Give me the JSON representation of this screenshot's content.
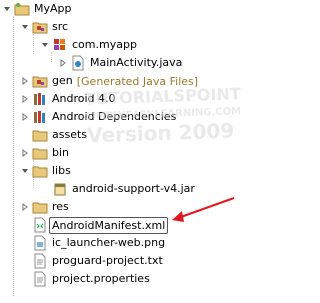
{
  "project": {
    "name": "MyApp",
    "items": [
      {
        "label": "src",
        "icon": "source-folder-icon"
      },
      {
        "label": "com.myapp",
        "icon": "package-icon"
      },
      {
        "label": "MainActivity.java",
        "icon": "java-file-icon"
      },
      {
        "label": "gen",
        "extra": "[Generated Java Files]",
        "icon": "source-folder-icon"
      },
      {
        "label": "Android 4.0",
        "icon": "library-icon"
      },
      {
        "label": "Android Dependencies",
        "icon": "library-icon"
      },
      {
        "label": "assets",
        "icon": "folder-icon"
      },
      {
        "label": "bin",
        "icon": "folder-icon"
      },
      {
        "label": "libs",
        "icon": "folder-icon"
      },
      {
        "label": "android-support-v4.jar",
        "icon": "jar-icon"
      },
      {
        "label": "res",
        "icon": "folder-icon"
      },
      {
        "label": "AndroidManifest.xml",
        "icon": "xml-file-icon"
      },
      {
        "label": "ic_launcher-web.png",
        "icon": "image-file-icon"
      },
      {
        "label": "proguard-project.txt",
        "icon": "text-file-icon"
      },
      {
        "label": "project.properties",
        "icon": "text-file-icon"
      }
    ]
  },
  "watermark": {
    "line1": "TUTORIALSPOINT",
    "line2": "SIMPLYEASYLEARNING.COM",
    "line3": "Version 2009"
  },
  "annotation": {
    "arrow_color": "#e0191f"
  }
}
